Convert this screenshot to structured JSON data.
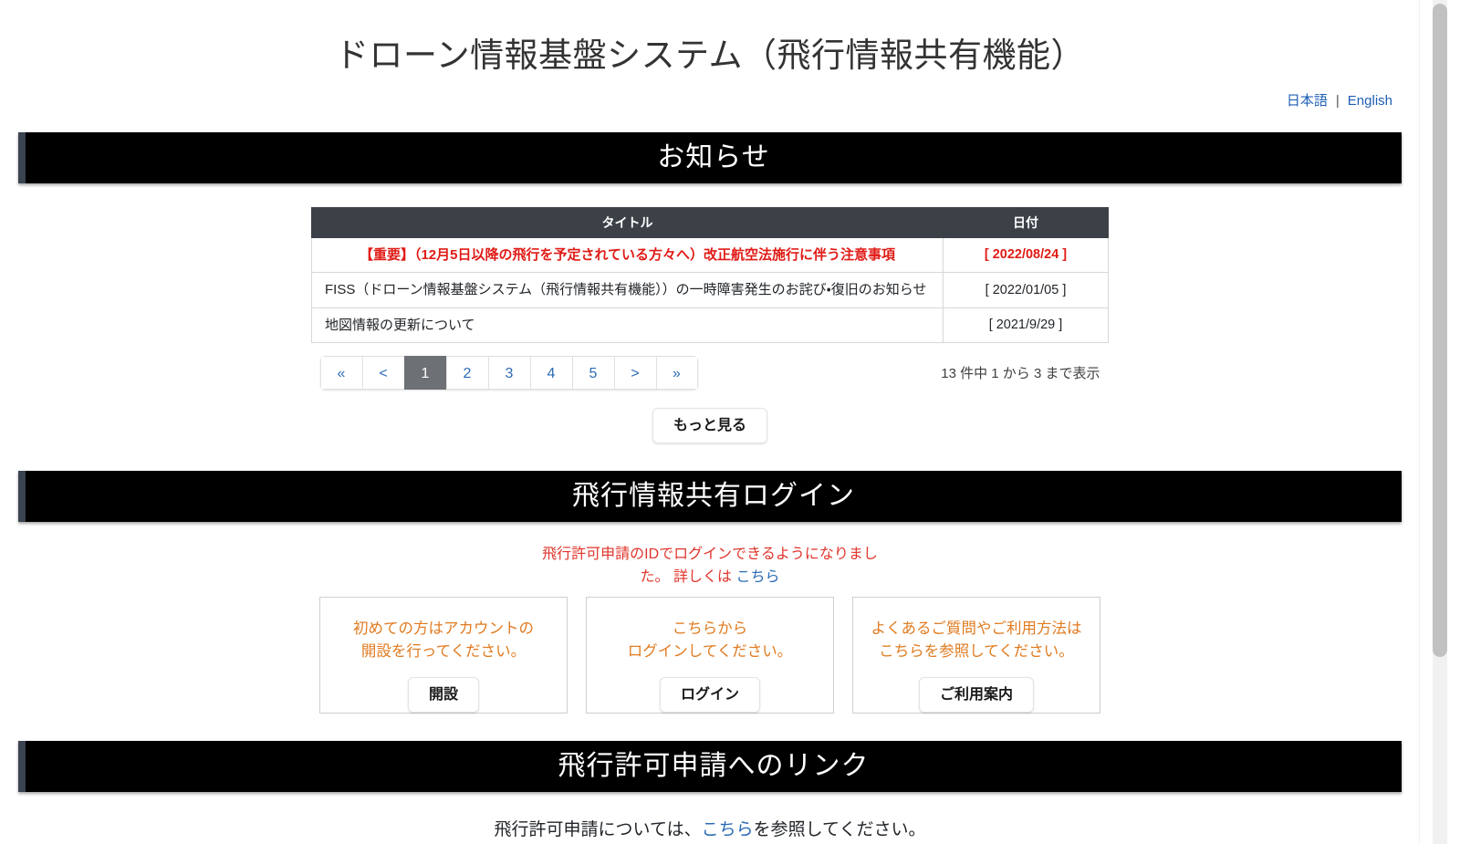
{
  "header": {
    "title": "ドローン情報基盤システム（飛行情報共有機能）",
    "lang": {
      "japanese": "日本語",
      "separator": "|",
      "english": "English"
    }
  },
  "notice_section": {
    "bar_title": "お知らせ",
    "table": {
      "headers": [
        "タイトル",
        "日付"
      ],
      "rows": [
        {
          "title": "【重要】（12月5日以降の飛行を予定されている方々へ）改正航空法施行に伴う注意事項",
          "date": "[ 2022/08/24 ]",
          "important": true
        },
        {
          "title": "FISS（ドローン情報基盤システム（飛行情報共有機能））の一時障害発生のお詫び・復旧のお知らせ",
          "date": "[ 2022/01/05 ]",
          "important": false
        },
        {
          "title": "地図情報の更新について",
          "date": "[ 2021/9/29 ]",
          "important": false
        }
      ]
    },
    "pagination": {
      "first": "«",
      "prev": "<",
      "pages": [
        "1",
        "2",
        "3",
        "4",
        "5"
      ],
      "active_page": "1",
      "next": ">",
      "last": "»"
    },
    "count_text": "13 件中 1 から 3 まで表示",
    "more_button": "もっと見る"
  },
  "login_section": {
    "bar_title": "飛行情報共有ログイン",
    "notice_line1": "飛行許可申請のIDでログインできるよ",
    "notice_line2": "うになりました。 詳しくは ",
    "notice_link": "こちら",
    "cards": [
      {
        "text_line1": "初めての方はアカウントの",
        "text_line2": "開設を行ってください。",
        "button": "開設"
      },
      {
        "text_line1": "こちらから",
        "text_line2": "ログインしてください。",
        "button": "ログイン"
      },
      {
        "text_line1": "よくあるご質問やご利用方法は",
        "text_line2": "こちらを参照してください。",
        "button": "ご利用案内"
      }
    ]
  },
  "permit_section": {
    "bar_title": "飛行許可申請へのリンク",
    "text_before": "飛行許可申請については、",
    "link": "こちら",
    "text_after": "を参照してください。"
  },
  "colors": {
    "bar_background": "#000000",
    "bar_left_border": "#3a4350",
    "table_header": "#3c4148",
    "important_red": "#e01b16",
    "notice_red": "#e0342b",
    "card_orange": "#e07b20",
    "link_blue": "#2d6cb5",
    "active_page": "#6d7175"
  }
}
